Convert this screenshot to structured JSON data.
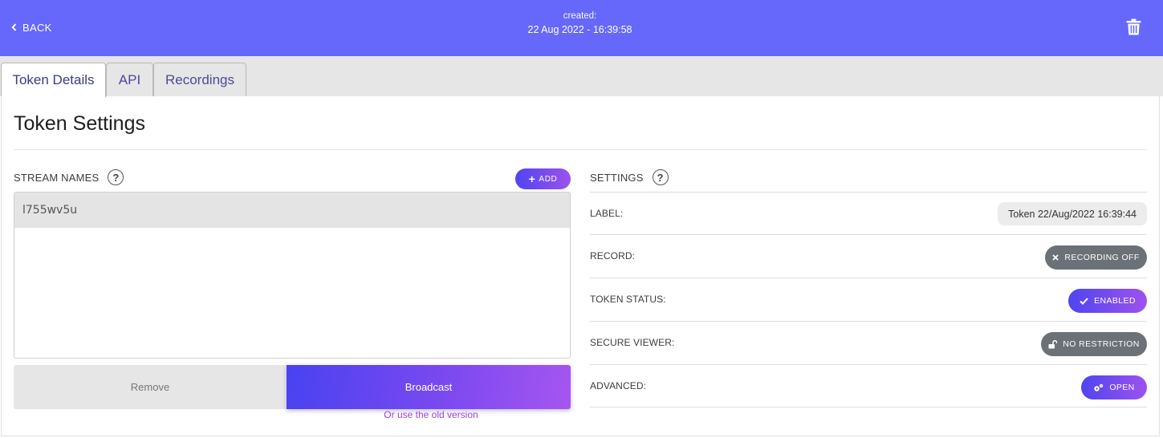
{
  "header": {
    "back_label": "BACK",
    "created_label": "created:",
    "created_value": "22 Aug 2022 - 16:39:58",
    "bg_color": "#6667fb"
  },
  "tabs": [
    {
      "label": "Token Details",
      "active": true
    },
    {
      "label": "API",
      "active": false
    },
    {
      "label": "Recordings",
      "active": false
    }
  ],
  "page_title": "Token Settings",
  "stream_names": {
    "heading": "STREAM NAMES",
    "help_glyph": "?",
    "add_label": "ADD",
    "items": [
      "l755wv5u"
    ],
    "remove_label": "Remove",
    "broadcast_label": "Broadcast",
    "old_version_link": "Or use the old version"
  },
  "settings": {
    "heading": "SETTINGS",
    "help_glyph": "?",
    "label_label": "LABEL:",
    "label_value": "Token 22/Aug/2022 16:39:44",
    "record_label": "RECORD:",
    "record_value": "RECORDING OFF",
    "status_label": "TOKEN STATUS:",
    "status_value": "ENABLED",
    "secure_label": "SECURE VIEWER:",
    "secure_value": "NO RESTRICTION",
    "advanced_label": "ADVANCED:",
    "advanced_value": "OPEN"
  },
  "colors": {
    "accent_start": "#4f45ef",
    "accent_end": "#9d52ef",
    "pill_grey": "#6b7177",
    "link": "#9a44d8"
  },
  "icons": [
    "chevron-left-icon",
    "trash-icon",
    "help-icon",
    "plus-icon",
    "x-icon",
    "check-icon",
    "unlock-icon",
    "gears-icon"
  ]
}
